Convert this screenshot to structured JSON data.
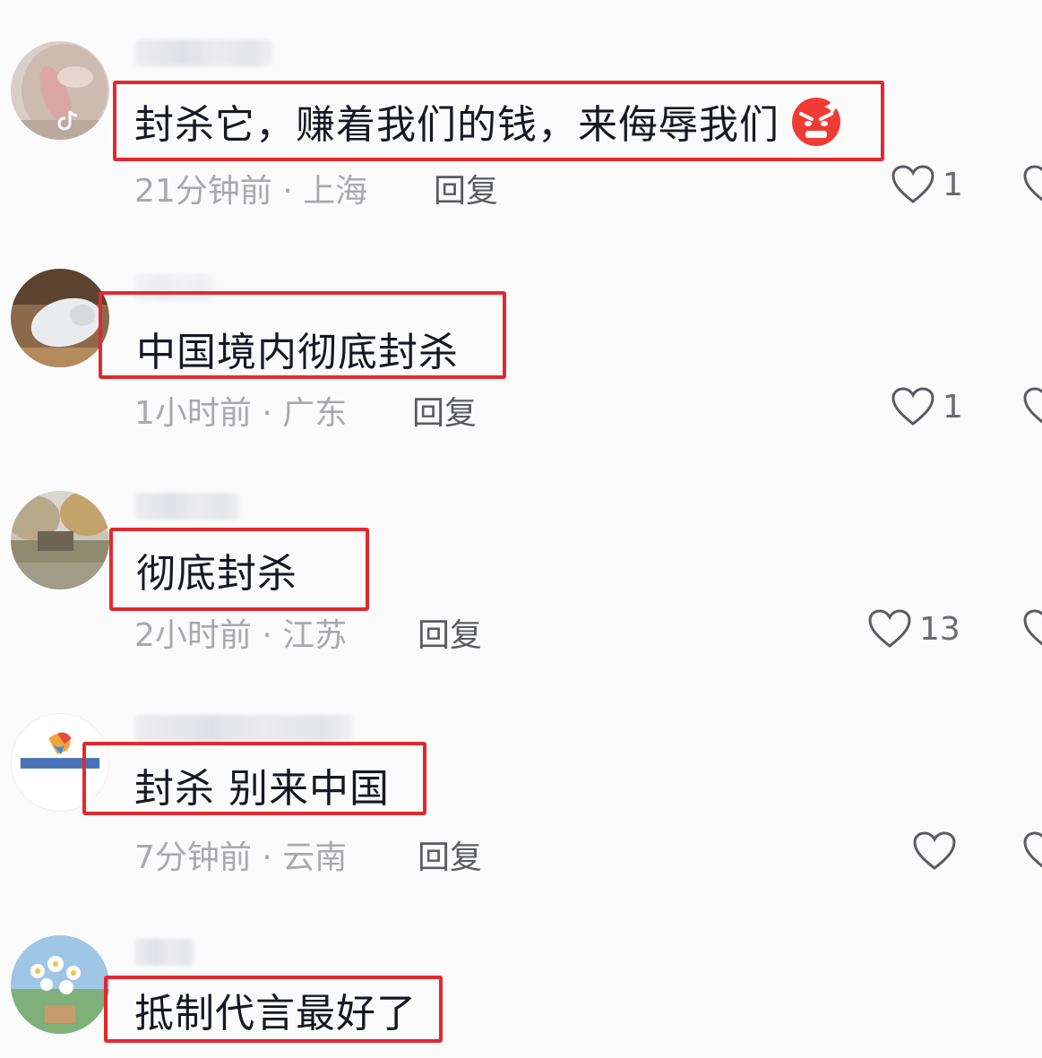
{
  "comments": [
    {
      "text": "封杀它，赚着我们的钱，来侮辱我们",
      "emoji": "angry-face",
      "time": "21分钟前 · 上海",
      "reply": "回复",
      "likes": "1"
    },
    {
      "text": "中国境内彻底封杀",
      "time": "1小时前 · 广东",
      "reply": "回复",
      "likes": "1"
    },
    {
      "text": "彻底封杀",
      "time": "2小时前 · 江苏",
      "reply": "回复",
      "likes": "13"
    },
    {
      "text": "封杀 别来中国",
      "time": "7分钟前 · 云南",
      "reply": "回复",
      "likes": ""
    },
    {
      "text": "抵制代言最好了"
    }
  ],
  "colors": {
    "highlight_border": "#e3282f",
    "comment_text": "#161823",
    "meta_text": "#a8a9ad"
  },
  "icons": {
    "like": "heart-outline-icon",
    "emoji": "angry-face-emoji",
    "platform": "tiktok-logo-icon"
  }
}
